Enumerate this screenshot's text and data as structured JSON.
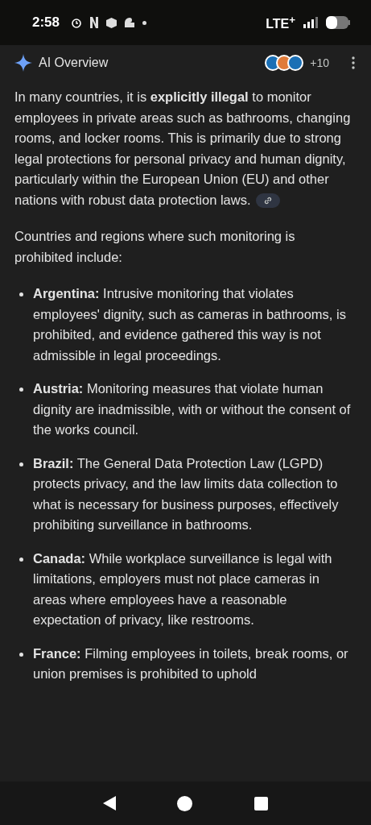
{
  "status_bar": {
    "time": "2:58",
    "network": "LTE$^{+}$"
  },
  "header": {
    "title": "AI Overview",
    "more_sources": "+10"
  },
  "summary": "In many countries, it is **explicitly illegal** to monitor employees in private areas such as bathrooms, changing rooms, and locker rooms. This is primarily due to strong legal protections for personal privacy and human dignity, particularly within the European Union (EU) and other nations with robust data protection laws.",
  "intro": "Countries and regions where such monitoring is prohibited include:",
  "items": [
    {
      "term": "Argentina:",
      "text": "Intrusive monitoring that violates employees' dignity, such as cameras in bathrooms, is prohibited, and evidence gathered this way is not admissible in legal proceedings."
    },
    {
      "term": "Austria:",
      "text": "Monitoring measures that violate human dignity are inadmissible, with or without the consent of the works council."
    },
    {
      "term": "Brazil:",
      "text": "The General Data Protection Law (LGPD) protects privacy, and the law limits data collection to what is necessary for business purposes, effectively prohibiting surveillance in bathrooms."
    },
    {
      "term": "Canada:",
      "text": "While workplace surveillance is legal with limitations, employers must not place cameras in areas where employees have a reasonable expectation of privacy, like restrooms."
    },
    {
      "term": "France:",
      "text": "Filming employees in toilets, break rooms, or union premises is prohibited to uphold"
    }
  ]
}
